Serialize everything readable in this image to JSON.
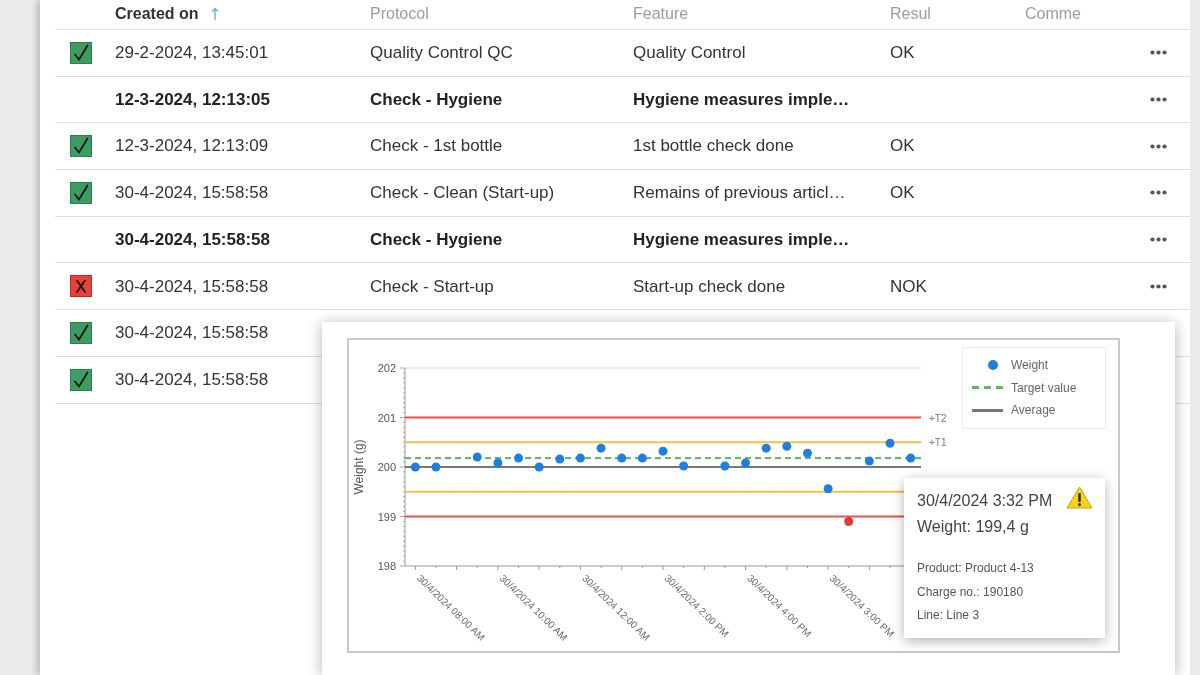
{
  "table": {
    "columns": [
      {
        "label": "Created on",
        "sorted": true
      },
      {
        "label": "Protocol",
        "sorted": false
      },
      {
        "label": "Feature",
        "sorted": false
      },
      {
        "label": "Resul",
        "sorted": false
      },
      {
        "label": "Comme",
        "sorted": false
      }
    ],
    "rows": [
      {
        "passed": true,
        "failed": false,
        "emphasized": false,
        "created": "29-2-2024, 13:45:01",
        "protocol": "Quality Control QC",
        "feature": "Quality Control",
        "result": "OK"
      },
      {
        "passed": false,
        "failed": false,
        "emphasized": true,
        "created": "12-3-2024, 12:13:05",
        "protocol": "Check - Hygiene",
        "feature": "Hygiene measures imple…"
      },
      {
        "passed": true,
        "failed": false,
        "emphasized": false,
        "created": "12-3-2024, 12:13:09",
        "protocol": "Check - 1st bottle",
        "feature": "1st bottle check done",
        "result": "OK"
      },
      {
        "passed": true,
        "failed": false,
        "emphasized": false,
        "created": "30-4-2024, 15:58:58",
        "protocol": "Check - Clean (Start-up)",
        "feature": "Remains of previous articl…",
        "result": "OK"
      },
      {
        "passed": false,
        "failed": false,
        "emphasized": true,
        "created": "30-4-2024, 15:58:58",
        "protocol": "Check - Hygiene",
        "feature": "Hygiene measures imple…"
      },
      {
        "passed": false,
        "failed": true,
        "emphasized": false,
        "created": "30-4-2024, 15:58:58",
        "protocol": "Check - Start-up",
        "feature": "Start-up check done",
        "result": "NOK"
      },
      {
        "passed": true,
        "failed": false,
        "emphasized": false,
        "created": "30-4-2024, 15:58:58"
      },
      {
        "passed": true,
        "failed": false,
        "emphasized": false,
        "created": "30-4-2024, 15:58:58"
      }
    ]
  },
  "chart_popup": {
    "chart_data": {
      "type": "scatter",
      "ylabel": "Weight (g)",
      "categories": [
        "30/4/2024 08:00 AM",
        null,
        null,
        null,
        "30/4/2024 10:00 AM",
        null,
        null,
        null,
        "30/4/2024 12:00 AM",
        null,
        null,
        null,
        "30/4/2024 2:00 PM",
        null,
        null,
        null,
        "30/4/2024 4:00 PM",
        null,
        null,
        null,
        "30/4/2024 3:00 PM",
        null,
        null,
        null,
        null
      ],
      "series": [
        {
          "color": "#1e7fe0",
          "values": [
            200.0,
            200.0,
            null,
            200.2,
            200.08,
            200.18,
            200.0,
            200.16,
            200.18,
            200.38,
            200.18,
            200.18,
            200.32,
            200.02,
            null,
            200.02,
            200.08,
            200.38,
            200.42,
            200.28,
            199.56,
            null,
            200.12,
            200.48,
            200.18
          ]
        },
        {
          "color": "#e53935",
          "values": [
            null,
            null,
            null,
            null,
            null,
            null,
            null,
            null,
            null,
            null,
            null,
            null,
            null,
            null,
            null,
            null,
            null,
            null,
            null,
            null,
            null,
            198.9,
            null,
            null,
            null
          ]
        }
      ],
      "ylim": [
        198,
        202
      ],
      "yticks": [
        198,
        199,
        200,
        201,
        202
      ],
      "ref_lines": [
        {
          "axis": "y",
          "value": 201,
          "color": "#ef5350",
          "label": "+T2"
        },
        {
          "axis": "y",
          "value": 200.5,
          "color": "#f5c344",
          "label": "+T1"
        },
        {
          "axis": "y",
          "value": 199.5,
          "color": "#f5c344"
        },
        {
          "axis": "y",
          "value": 199,
          "color": "#ef5350"
        },
        {
          "axis": "y",
          "value": 200,
          "color": "#777777"
        },
        {
          "axis": "y",
          "value": 200.18,
          "color": "#5cb85c"
        }
      ]
    },
    "legend": [
      {
        "label": "Weight",
        "kind": "dot",
        "color": "#1e7fe0"
      },
      {
        "label": "Target value",
        "kind": "dashed",
        "color": "#5cb85c"
      },
      {
        "label": "Average",
        "kind": "solid",
        "color": "#777777"
      }
    ],
    "tooltip": {
      "title": "30/4/2024 3:32 PM",
      "warning": true,
      "value": "Weight: 199,4 g",
      "details": [
        "Product: Product 4-13",
        "Charge no.: 190180",
        "Line: Line 3"
      ]
    }
  }
}
